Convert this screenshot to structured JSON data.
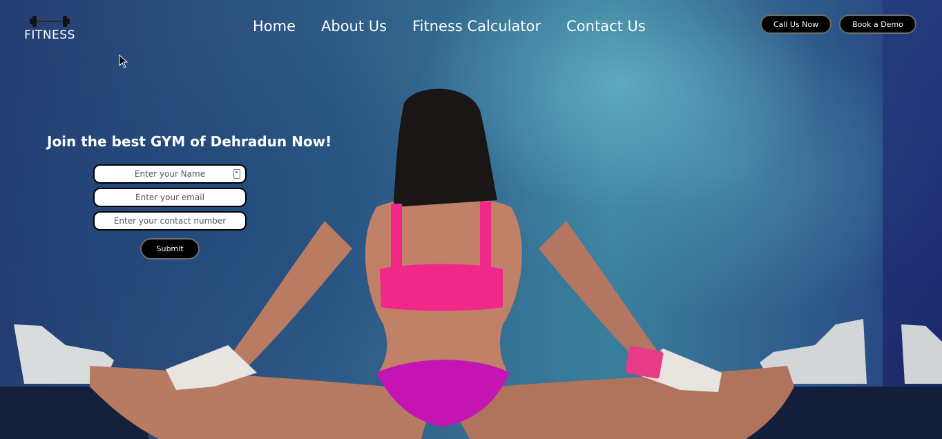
{
  "header": {
    "logo_text": "FITNESS",
    "logo_icon": "barbell-icon",
    "nav": [
      {
        "label": "Home"
      },
      {
        "label": "About Us"
      },
      {
        "label": "Fitness Calculator"
      },
      {
        "label": "Contact Us"
      }
    ],
    "call_button": "Call Us Now",
    "demo_button": "Book a Demo"
  },
  "hero": {
    "headline": "Join the best GYM of Dehradun Now!",
    "form": {
      "name_placeholder": "Enter your Name",
      "email_placeholder": "Enter your email",
      "contact_placeholder": "Enter your contact number",
      "submit_label": "Submit"
    }
  },
  "colors": {
    "button_bg": "#000000",
    "text": "#ffffff",
    "top_pink": "#f0288a",
    "bottom_magenta": "#c414b4"
  }
}
